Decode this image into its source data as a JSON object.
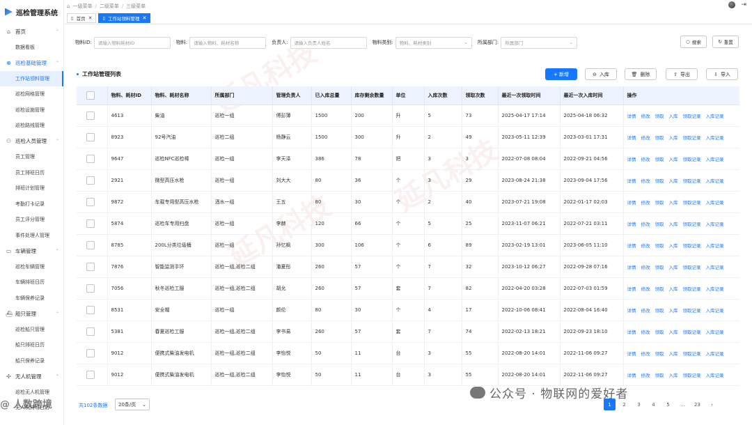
{
  "app": {
    "title": "巡检管理系统"
  },
  "breadcrumb": [
    "一级菜单",
    "二级菜单",
    "三级菜单"
  ],
  "tabs": [
    {
      "label": "首页"
    },
    {
      "label": "工作站领料管理"
    }
  ],
  "sidebar": {
    "groups": [
      {
        "label": "首页",
        "icon": "home-icon",
        "items": [
          {
            "label": "数据看板"
          }
        ]
      },
      {
        "label": "巡检基础管理",
        "icon": "inspection-icon",
        "active": true,
        "items": [
          {
            "label": "工作站领料管理",
            "active": true
          },
          {
            "label": "巡检网格管理"
          },
          {
            "label": "巡检设施管理"
          },
          {
            "label": "巡检路线管理"
          }
        ]
      },
      {
        "label": "巡检人员管理",
        "icon": "people-icon",
        "items": [
          {
            "label": "员工管理"
          },
          {
            "label": "员工排班日历"
          },
          {
            "label": "排班计划管理"
          },
          {
            "label": "考勤打卡记录"
          },
          {
            "label": "员工评分管理"
          },
          {
            "label": "事件处理人管理"
          }
        ]
      },
      {
        "label": "车辆管理",
        "icon": "car-icon",
        "items": [
          {
            "label": "巡检车辆管理"
          },
          {
            "label": "车辆排班日历"
          },
          {
            "label": "车辆保养记录"
          }
        ]
      },
      {
        "label": "船只管理",
        "icon": "ship-icon",
        "items": [
          {
            "label": "巡检船只管理"
          },
          {
            "label": "船只排班日历"
          },
          {
            "label": "船只保养记录"
          }
        ]
      },
      {
        "label": "无人机管理",
        "icon": "drone-icon",
        "items": [
          {
            "label": "巡检无人机管理"
          },
          {
            "label": "无人机排班日历"
          }
        ]
      }
    ]
  },
  "filters": [
    {
      "label": "物料ID:",
      "placeholder": "请输入物料耗材ID",
      "type": "input"
    },
    {
      "label": "物料:",
      "placeholder": "请输入物料、耗材名称",
      "type": "input"
    },
    {
      "label": "负责人:",
      "placeholder": "请输入负责人姓名",
      "type": "input"
    },
    {
      "label": "物料类别:",
      "placeholder": "物料、耗材类别",
      "type": "select"
    },
    {
      "label": "所属部门:",
      "placeholder": "所属部门",
      "type": "select"
    }
  ],
  "filter_buttons": {
    "search": "搜索",
    "reset": "重置"
  },
  "list_title": "工作站管理列表",
  "actions": {
    "add": "+ 新增",
    "in": "入库",
    "delete": "删除",
    "export": "导出",
    "import": "导入"
  },
  "table": {
    "headers": [
      "物料、耗材ID",
      "物料、耗材名称",
      "所属部门",
      "管理负责人",
      "已入库总量",
      "库存剩余数量",
      "单位",
      "入库次数",
      "领取次数",
      "最近一次领取时间",
      "最近一次入库时间",
      "操作"
    ],
    "ops": [
      "详情",
      "修改",
      "领取",
      "入库",
      "领取记录",
      "入库记录"
    ],
    "rows": [
      [
        "4613",
        "柴油",
        "巡检一组",
        "傅彭薄",
        "1500",
        "200",
        "升",
        "5",
        "73",
        "2025-04-17 17:14",
        "2025-04-18 06:32"
      ],
      [
        "8923",
        "92号汽油",
        "巡检二组",
        "杨静云",
        "1500",
        "300",
        "升",
        "2",
        "49",
        "2023-05-11 12:39",
        "2023-03-01 17:31"
      ],
      [
        "9647",
        "巡检NFC巡检棒",
        "巡检一组",
        "李天泽",
        "386",
        "78",
        "把",
        "3",
        "3",
        "2022-07-08 08:04",
        "2022-09-21 04:56"
      ],
      [
        "2921",
        "微型高压水枪",
        "巡检一组",
        "刘大大",
        "80",
        "36",
        "个",
        "3",
        "29",
        "2023-08-24 21:38",
        "2023-09-04 17:56"
      ],
      [
        "9872",
        "车载专用型高压水枪",
        "洒水一组",
        "王五",
        "80",
        "30",
        "个",
        "2",
        "40",
        "2023-07-21 19:08",
        "2022-01-17 02:03"
      ],
      [
        "5874",
        "巡检车专用扫盘",
        "巡检一组",
        "李赫",
        "120",
        "66",
        "个",
        "5",
        "25",
        "2023-11-07 06:21",
        "2022-07-21 03:11"
      ],
      [
        "8785",
        "200L分类垃圾桶",
        "巡检一组",
        "孙忆枫",
        "300",
        "106",
        "个",
        "6",
        "89",
        "2023-02-19 13:01",
        "2023-06-05 11:10"
      ],
      [
        "7876",
        "智能监测手环",
        "巡检一组,巡检二组",
        "潘夏彤",
        "260",
        "57",
        "个",
        "7",
        "32",
        "2023-10-12 06:27",
        "2022-09-28 07:16"
      ],
      [
        "7056",
        "秋冬巡检工服",
        "巡检一组,巡检二组",
        "胡允",
        "260",
        "57",
        "套",
        "7",
        "82",
        "2022-04-20 03:28",
        "2022-07-03 01:59"
      ],
      [
        "8531",
        "安全帽",
        "巡检一组",
        "颜伦",
        "80",
        "30",
        "个",
        "4",
        "17",
        "2022-10-06 08:41",
        "2022-08-04 16:40"
      ],
      [
        "5381",
        "春夏巡检工服",
        "巡检一组,巡检二组",
        "李书易",
        "260",
        "57",
        "套",
        "7",
        "74",
        "2022-02-13 18:21",
        "2022-09-23 18:10"
      ],
      [
        "9012",
        "便携式柴油发电机",
        "巡检一组,巡检二组",
        "李怡悦",
        "50",
        "11",
        "台",
        "3",
        "55",
        "2022-08-20 14:01",
        "2022-11-06 09:27"
      ],
      [
        "9012",
        "便携式柴油发电机",
        "巡检一组,巡检二组",
        "李怡悦",
        "50",
        "11",
        "台",
        "3",
        "55",
        "2022-08-20 14:01",
        "2022-11-06 09:27"
      ]
    ]
  },
  "footer": {
    "total": "共102条数据",
    "page_size": "20条/页",
    "pages": [
      "1",
      "2",
      "3",
      "4",
      "5",
      "…",
      "23"
    ],
    "current_page": "1"
  },
  "overlays": {
    "wechat_text": "公众号 · 物联网的爱好者",
    "bottom_left": "@ 人数跨境"
  },
  "watermark": "延凡科技"
}
